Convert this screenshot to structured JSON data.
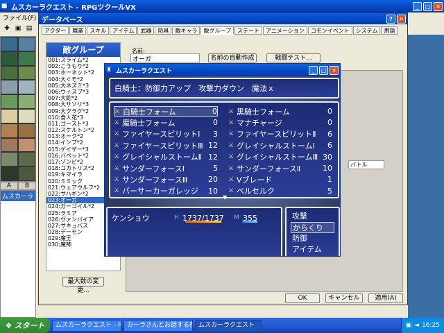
{
  "app": {
    "title": "ムスカーラクエスト - RPGツクールVX",
    "menu_file": "ファイル(F)"
  },
  "tilesets": {
    "tab_a": "A",
    "tab_b": "B"
  },
  "maplist": {
    "item": "ムスカーラ"
  },
  "database": {
    "title": "データベース",
    "tabs": [
      "アクター",
      "職業",
      "スキル",
      "アイテム",
      "武器",
      "防具",
      "敵キャラ",
      "敵グループ",
      "ステート",
      "アニメーション",
      "コモンイベント",
      "システム",
      "用語"
    ],
    "panel_title": "敵グループ",
    "groups": [
      "001:スライム*2",
      "002:こうもり*2",
      "003:ホーネット*2",
      "004:大ぐモ*2",
      "005:大ネズミ*3",
      "006:ウィスプ*3",
      "007:大蛇*2",
      "008:大サソリ*3",
      "009:大クラグ*2",
      "010:食人花*3",
      "011:ゴースト*3",
      "012:スケルトン*2",
      "013:オーク*2",
      "014:インプ*2",
      "015:ゲイザー*3",
      "016:バペット*2",
      "017:ゾンビ*2",
      "018:コカトリス*2",
      "019:キマイラ",
      "020:ミミック",
      "021:ウェアウルフ*2",
      "022:サハギン*2",
      "023:オーガ",
      "024:ガーゴイル*2",
      "025:ラミア",
      "026:ヴァンパイア",
      "027:サキュバス",
      "028:デーモン",
      "029:魔王",
      "030:魔神"
    ],
    "max_button": "最大数の変更...",
    "name_label": "名前:",
    "name_value": "オーガ",
    "auto_name_button": "名前の自動作成",
    "battle_test_button": "戦闘テスト...",
    "bg_select": "バトル",
    "ok": "OK",
    "cancel": "キャンセル",
    "apply": "適用(A)"
  },
  "game": {
    "title": "ムスカーラクエスト",
    "help": "白騎士：防御力アップ　攻撃力ダウン　魔法ｘ",
    "skills": [
      {
        "name": "白騎士フォーム",
        "cost": "0"
      },
      {
        "name": "黒騎士フォーム",
        "cost": "0"
      },
      {
        "name": "魔騎士フォーム",
        "cost": "0"
      },
      {
        "name": "マナチャージ",
        "cost": "0"
      },
      {
        "name": "ファイヤースピリットⅠ",
        "cost": "3"
      },
      {
        "name": "ファイヤースピリットⅡ",
        "cost": "6"
      },
      {
        "name": "ファイヤースピリットⅢ",
        "cost": "12"
      },
      {
        "name": "グレイシャルストームⅠ",
        "cost": "6"
      },
      {
        "name": "グレイシャルストームⅡ",
        "cost": "12"
      },
      {
        "name": "グレイシャルストームⅢ",
        "cost": "30"
      },
      {
        "name": "サンダーフォースⅠ",
        "cost": "5"
      },
      {
        "name": "サンダーフォースⅡ",
        "cost": "10"
      },
      {
        "name": "サンダーフォースⅢ",
        "cost": "20"
      },
      {
        "name": "Vブレード",
        "cost": "1"
      },
      {
        "name": "バーサーカーガレッジ",
        "cost": "10"
      },
      {
        "name": "ベルセルク",
        "cost": "5"
      }
    ],
    "actor": {
      "name": "ケンショウ",
      "hp_label": "H",
      "hp": "1737/1737",
      "mp_label": "M",
      "mp": "355",
      "hp_ratio": 1.0,
      "mp_ratio": 1.0
    },
    "commands": [
      "攻撃",
      "からくり",
      "防御",
      "アイテム"
    ]
  },
  "taskbar": {
    "start": "スタート",
    "tasks": [
      "ムスカーラクエスト - RP...",
      "カーラさんとお話する部...",
      "ムスカーラクエスト"
    ],
    "clock": "16:25"
  },
  "colors": {
    "xp_blue": "#0a5fe0",
    "window_blue": "#1d2c74",
    "selection": "#316ac5"
  }
}
